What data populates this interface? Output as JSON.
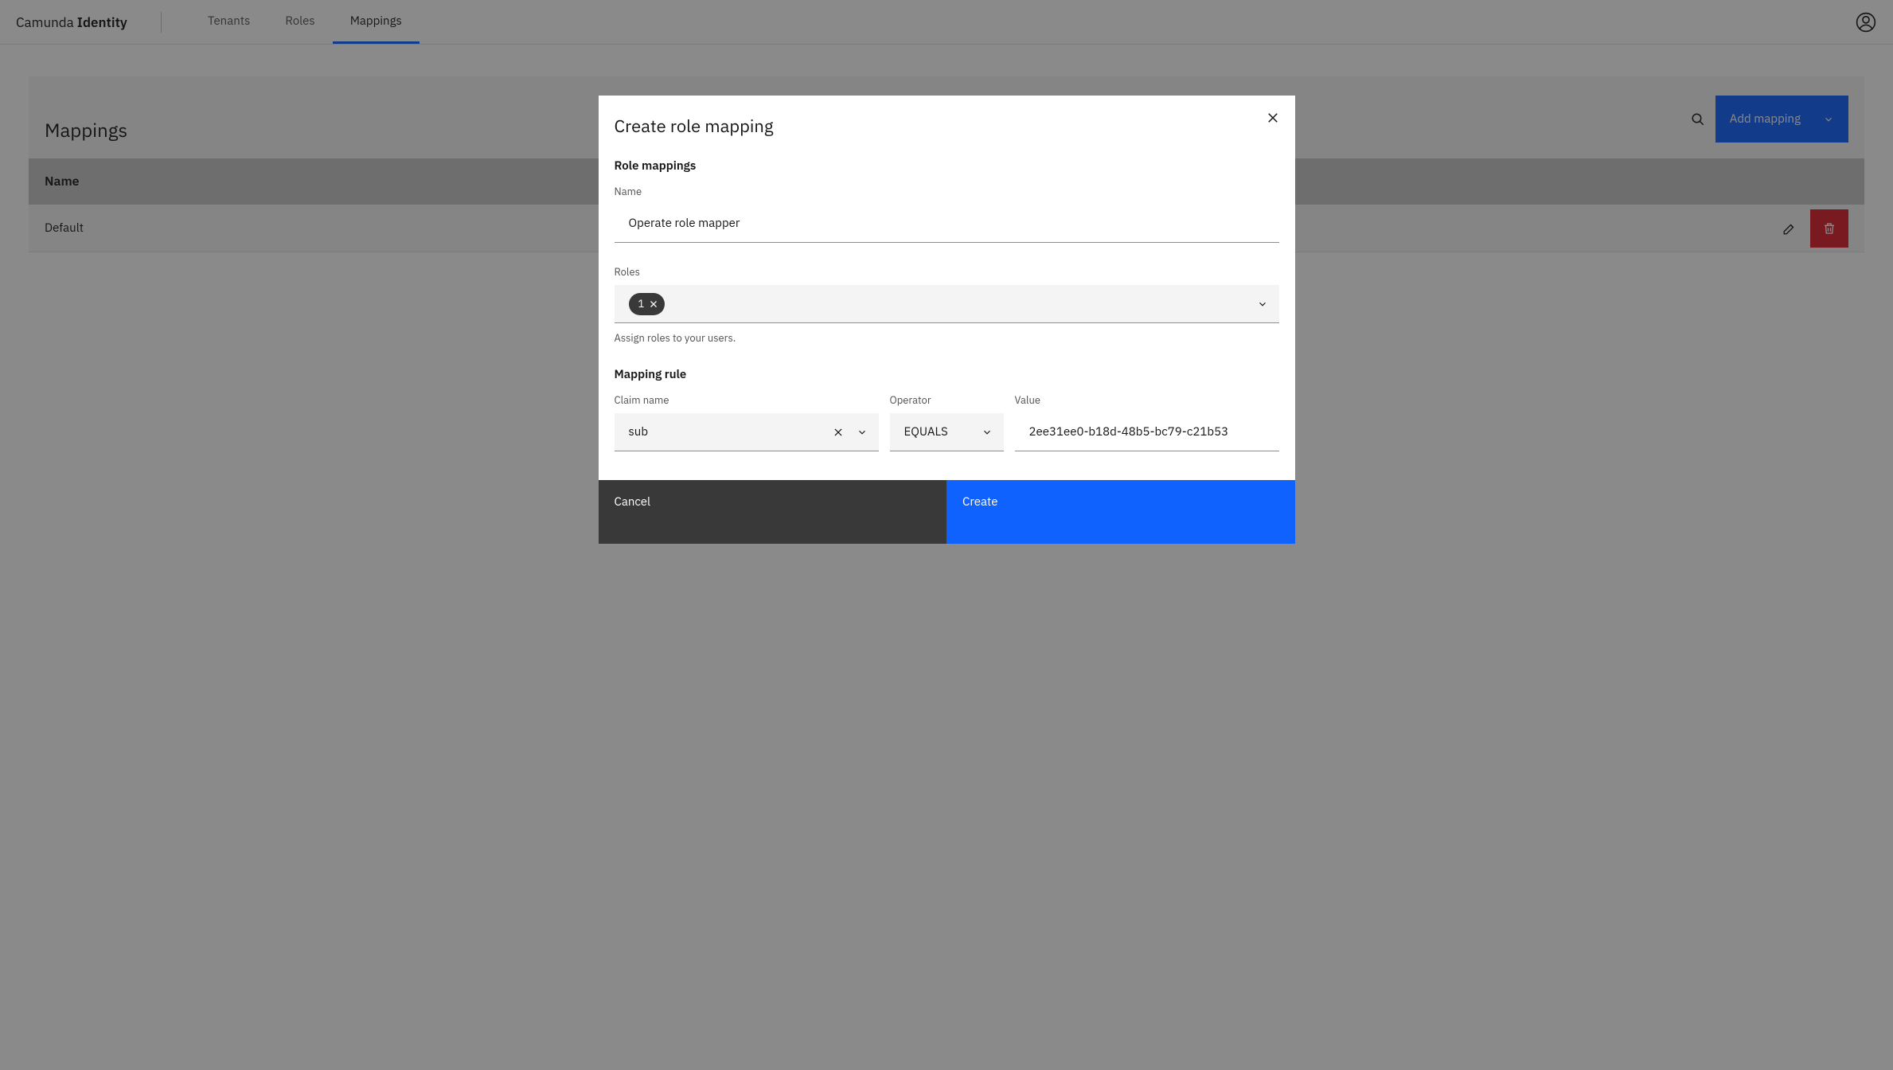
{
  "brand": {
    "first": "Camunda ",
    "second": "Identity"
  },
  "nav": {
    "items": [
      {
        "label": "Tenants",
        "active": false
      },
      {
        "label": "Roles",
        "active": false
      },
      {
        "label": "Mappings",
        "active": true
      }
    ]
  },
  "page": {
    "title": "Mappings",
    "add_button_label": "Add mapping",
    "table": {
      "header": {
        "name": "Name"
      },
      "rows": [
        {
          "name": "Default"
        }
      ]
    }
  },
  "modal": {
    "title": "Create role mapping",
    "sections": {
      "role_mappings": {
        "heading": "Role mappings",
        "name_label": "Name",
        "name_value": "Operate role mapper",
        "roles_label": "Roles",
        "roles_selected_count": "1",
        "roles_helper": "Assign roles to your users."
      },
      "mapping_rule": {
        "heading": "Mapping rule",
        "claim_label": "Claim name",
        "claim_value": "sub",
        "operator_label": "Operator",
        "operator_value": "EQUALS",
        "value_label": "Value",
        "value_value": "2ee31ee0-b18d-48b5-bc79-c21b53"
      }
    },
    "footer": {
      "cancel": "Cancel",
      "create": "Create"
    }
  }
}
